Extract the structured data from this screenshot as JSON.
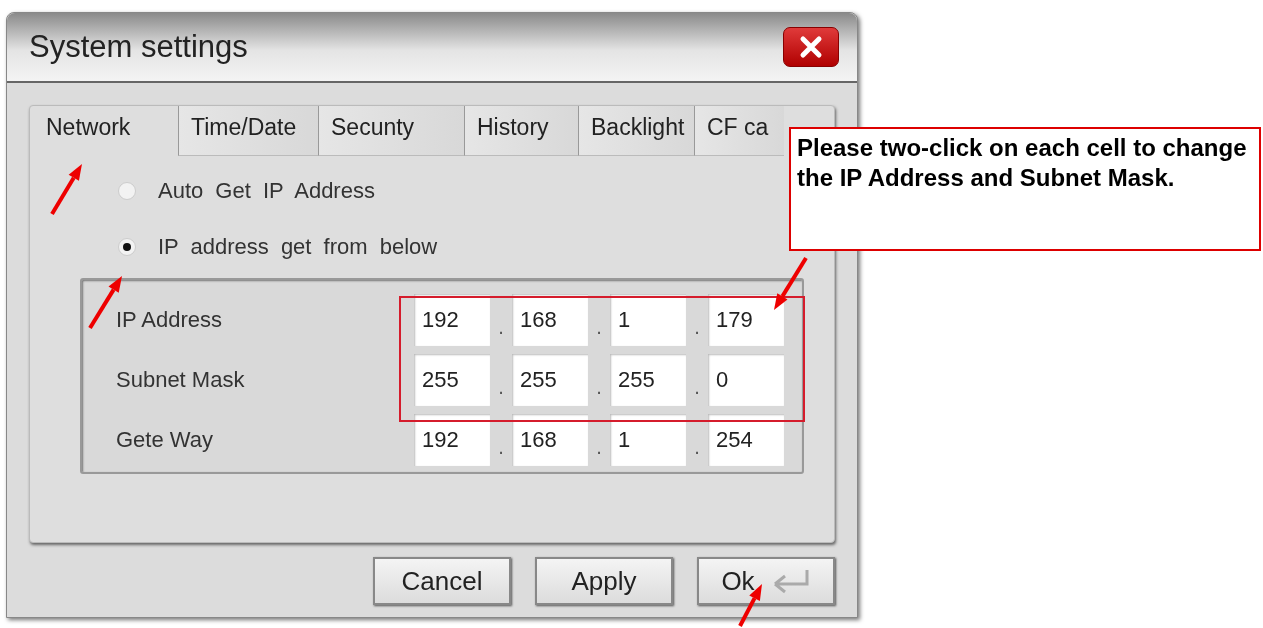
{
  "window": {
    "title": "System settings"
  },
  "tabs": [
    {
      "label": "Network",
      "selected": true
    },
    {
      "label": "Time/Date",
      "selected": false
    },
    {
      "label": "Secunty",
      "selected": false
    },
    {
      "label": "History",
      "selected": false
    },
    {
      "label": "Backlight",
      "selected": false
    },
    {
      "label": "CF ca",
      "selected": false
    }
  ],
  "radios": [
    {
      "label": "Auto Get IP Address",
      "selected": false
    },
    {
      "label": "IP address get from below",
      "selected": true
    }
  ],
  "address_rows": [
    {
      "label": "IP Address",
      "octets": [
        "192",
        "168",
        "1",
        "179"
      ],
      "separators": [
        ".",
        ".",
        "."
      ]
    },
    {
      "label": "Subnet Mask",
      "octets": [
        "255",
        "255",
        "255",
        "0"
      ],
      "separators": [
        ".",
        ".",
        "."
      ]
    },
    {
      "label": "Gete Way",
      "octets": [
        "192",
        "168",
        "1",
        "254"
      ],
      "separators": [
        ".",
        ".",
        "."
      ]
    }
  ],
  "buttons": [
    "Cancel",
    "Apply",
    "Ok"
  ],
  "callout": {
    "text": "Please two-click on each cell to change the IP Address and Subnet Mask."
  }
}
